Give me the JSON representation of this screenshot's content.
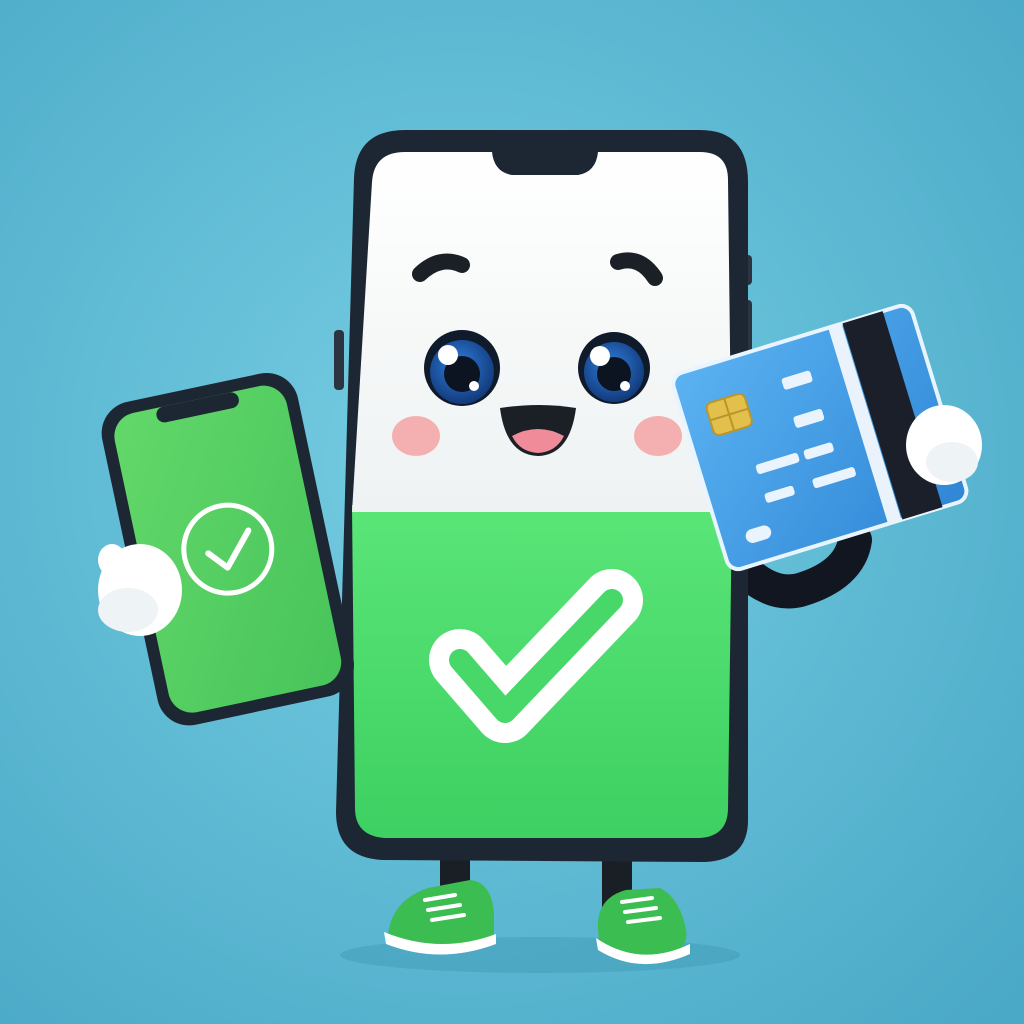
{
  "scene": {
    "subject": "phone-mascot",
    "icons": [
      "checkmark-icon",
      "credit-card-icon",
      "smartphone-icon"
    ]
  },
  "colors": {
    "background_light": "#6fc8df",
    "background_dark": "#4fb0cc",
    "phone_frame": "#1d2733",
    "screen_white": "#f6f8f8",
    "screen_green": "#4fe06f",
    "small_phone_green": "#5fd460",
    "card_blue": "#3d9be6",
    "card_stripe": "#1a1f2a",
    "chip_gold": "#e3c04b",
    "shoe_green": "#36b84f",
    "cheek_pink": "#f4a3a3",
    "eye_blue": "#1d5fc4"
  }
}
